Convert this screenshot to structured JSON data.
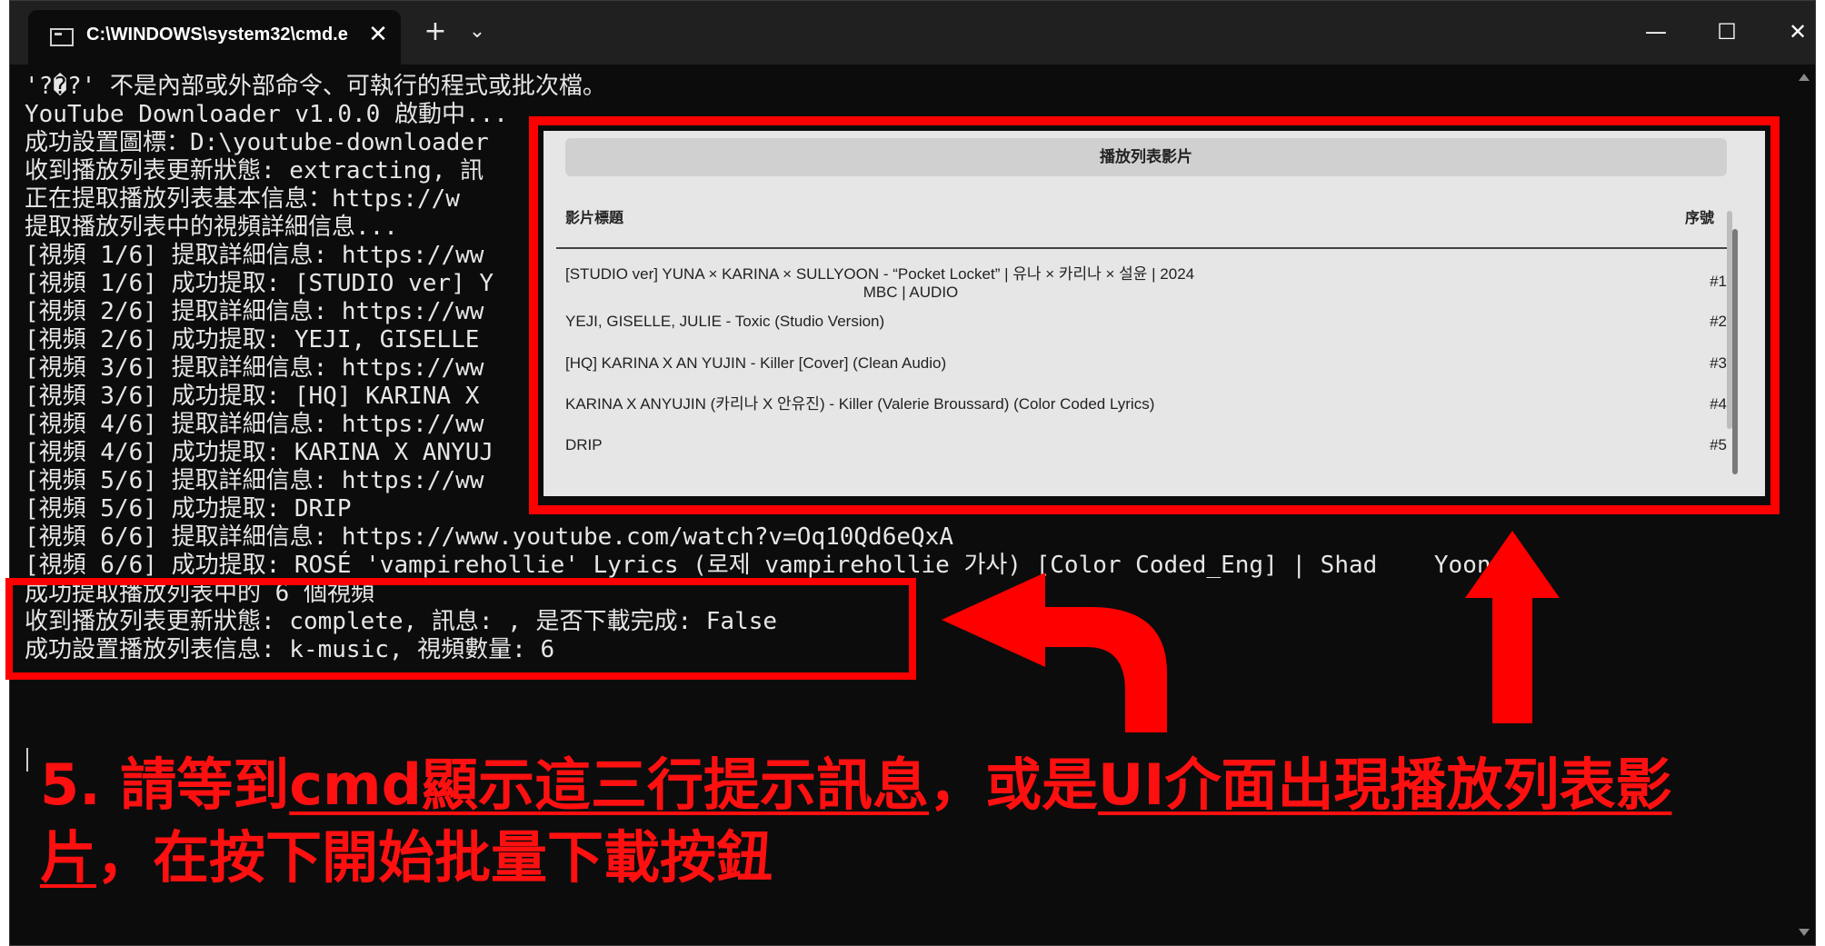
{
  "window": {
    "tab_title": "C:\\WINDOWS\\system32\\cmd.e",
    "tab_close": "✕",
    "new_tab": "+",
    "dropdown": "⌄",
    "minimize": "—",
    "maximize": "☐",
    "close": "✕"
  },
  "terminal": {
    "lines": [
      "'?�?' 不是內部或外部命令、可執行的程式或批次檔。",
      "YouTube Downloader v1.0.0 啟動中...",
      "成功設置圖標：D:\\youtube-downloader",
      "收到播放列表更新狀態: extracting, 訊",
      "正在提取播放列表基本信息：https://w",
      "提取播放列表中的視頻詳細信息...",
      "[視頻 1/6] 提取詳細信息: https://ww",
      "[視頻 1/6] 成功提取: [STUDIO ver] Y",
      "[視頻 2/6] 提取詳細信息: https://ww",
      "[視頻 2/6] 成功提取: YEJI, GISELLE",
      "[視頻 3/6] 提取詳細信息: https://ww",
      "[視頻 3/6] 成功提取: [HQ] KARINA X",
      "[視頻 4/6] 提取詳細信息: https://ww",
      "[視頻 4/6] 成功提取: KARINA X ANYUJ",
      "[視頻 5/6] 提取詳細信息: https://ww",
      "[視頻 5/6] 成功提取: DRIP",
      "[視頻 6/6] 提取詳細信息: https://www.youtube.com/watch?v=Oq10Qd6eQxA",
      "[視頻 6/6] 成功提取: ROSÉ 'vampirehollie' Lyrics (로제 vampirehollie 가사) [Color Coded_Eng] | Shad    Yoongi",
      "成功提取播放列表中的 6 個視頻",
      "收到播放列表更新狀態: complete, 訊息: , 是否下載完成: False",
      "成功設置播放列表信息: k-music, 視頻數量: 6"
    ]
  },
  "popup": {
    "header": "播放列表影片",
    "col_title": "影片標題",
    "col_index": "序號",
    "rows": [
      {
        "title": "[STUDIO ver] YUNA × KARINA × SULLYOON - “Pocket Locket” | 유나 × 카리나 × 설윤 | 2024",
        "title2": "MBC | AUDIO",
        "index": "#1"
      },
      {
        "title": "YEJI, GISELLE, JULIE - Toxic (Studio Version)",
        "title2": "",
        "index": "#2"
      },
      {
        "title": "[HQ] KARINA X AN YUJIN - Killer [Cover] (Clean Audio)",
        "title2": "",
        "index": "#3"
      },
      {
        "title": "KARINA X ANYUJIN (카리나 X 안유진) - Killer (Valerie Broussard) (Color Coded Lyrics)",
        "title2": "",
        "index": "#4"
      },
      {
        "title": "DRIP",
        "title2": "",
        "index": "#5"
      }
    ]
  },
  "instruction": {
    "line1_a": "5. 請等到",
    "line1_b": "cmd顯示這三行提示訊息",
    "line1_c": "，或是",
    "line1_d": "UI介面出現播放列表影",
    "line2_a": "片",
    "line2_b": "，在按下開始批量下載按鈕"
  },
  "colors": {
    "annotation": "#ff0000",
    "terminal_bg": "#0c0c0c",
    "terminal_text": "#e6e6e6"
  }
}
